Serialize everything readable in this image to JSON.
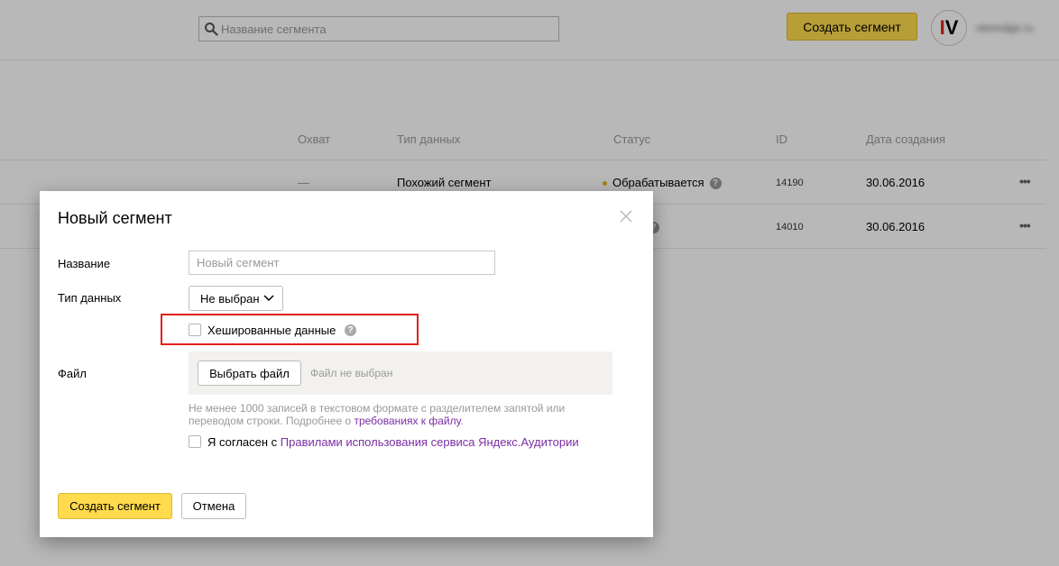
{
  "header": {
    "search_placeholder": "Название сегмента",
    "create_button": "Создать сегмент",
    "avatar_letters": [
      "I",
      "V"
    ],
    "login": "stenodge.ru"
  },
  "table": {
    "columns": [
      "Охват",
      "Тип данных",
      "Статус",
      "ID",
      "Дата создания"
    ],
    "rows": [
      {
        "coverage": "—",
        "type": "Похожий сегмент",
        "status": "Обрабатывается",
        "id": "14190",
        "date": "30.06.2016",
        "menu": "•••"
      },
      {
        "coverage": "",
        "type": "",
        "status": "",
        "id": "14010",
        "date": "30.06.2016",
        "menu": "•••"
      }
    ]
  },
  "modal": {
    "title": "Новый сегмент",
    "name_label": "Название",
    "name_placeholder": "Новый сегмент",
    "type_label": "Тип данных",
    "type_value": "Не выбран",
    "hashed_label": "Хешированные данные",
    "file_label": "Файл",
    "file_button": "Выбрать файл",
    "file_status": "Файл не выбран",
    "hint_text": "Не менее 1000 записей в текстовом формате с разделителем запятой или переводом строки. Подробнее о ",
    "hint_link": "требованиях к файлу",
    "hint_end": ".",
    "agree_text": "Я согласен с ",
    "agree_link": "Правилами использования сервиса Яндекс.Аудитории",
    "submit_button": "Создать сегмент",
    "cancel_button": "Отмена"
  },
  "colors": {
    "accent": "#ffdb4d",
    "link": "#7b2ea3",
    "highlight": "#e3201b",
    "status_dot": "#e8b81d"
  },
  "icons": {
    "search": "search-icon",
    "close": "close-icon",
    "chevron": "chevron-down-icon",
    "help": "question-icon",
    "menu": "more-icon"
  }
}
